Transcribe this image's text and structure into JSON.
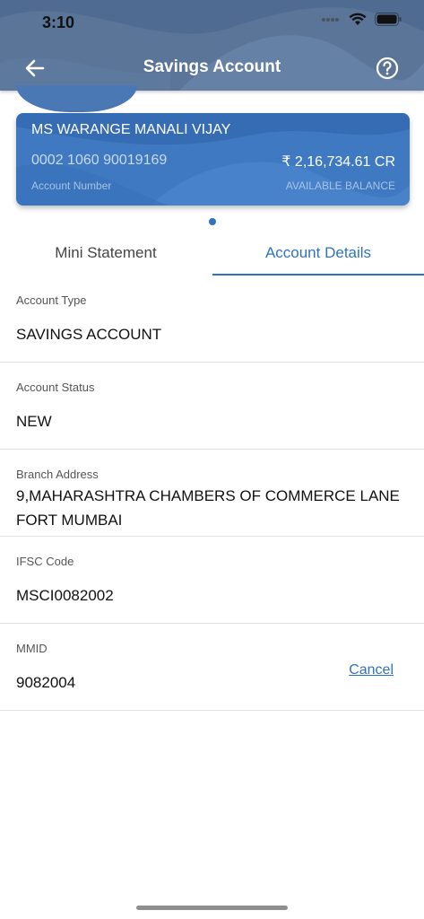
{
  "status_bar": {
    "time": "3:10"
  },
  "header": {
    "title": "Savings Account"
  },
  "account_card": {
    "name": "MS WARANGE MANALI VIJAY",
    "account_number": "0002 1060 90019169",
    "account_number_label": "Account Number",
    "balance": "₹ 2,16,734.61 CR",
    "balance_label": "AVAILABLE BALANCE"
  },
  "tabs": [
    {
      "label": "Mini Statement",
      "active": false
    },
    {
      "label": "Account Details",
      "active": true
    }
  ],
  "details": [
    {
      "label": "Account Type",
      "value": "SAVINGS ACCOUNT"
    },
    {
      "label": "Account Status",
      "value": "NEW"
    },
    {
      "label": "Branch Address",
      "value": "9,MAHARASHTRA CHAMBERS OF COMMERCE LANE FORT MUMBAI"
    },
    {
      "label": "IFSC Code",
      "value": "MSCI0082002"
    },
    {
      "label": "MMID",
      "value": "9082004",
      "action": "Cancel"
    }
  ],
  "colors": {
    "header": "#5b7598",
    "card": "#3f79c2",
    "accent": "#2f73c0"
  },
  "icons": [
    "back-arrow-icon",
    "help-icon",
    "wifi-icon",
    "battery-icon",
    "signal-icon"
  ]
}
